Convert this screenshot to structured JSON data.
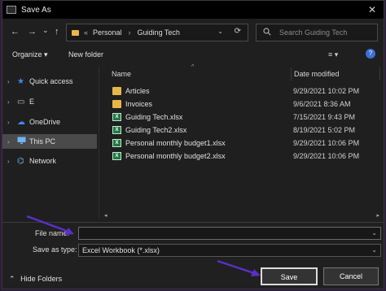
{
  "window": {
    "title": "Save As",
    "close_glyph": "✕"
  },
  "nav": {
    "back_glyph": "←",
    "forward_glyph": "→",
    "recent_glyph": "⌄",
    "up_glyph": "↑",
    "breadcrumb": {
      "prefix": "«",
      "items": [
        "Personal",
        "Guiding Tech"
      ],
      "separator": "›"
    },
    "dropdown_glyph": "⌄",
    "refresh_glyph": "⟳"
  },
  "search": {
    "placeholder": "Search Guiding Tech",
    "icon": "search-icon"
  },
  "toolbar": {
    "organize": "Organize ▾",
    "new_folder": "New folder",
    "view_glyph": "≡ ▾",
    "help_glyph": "?"
  },
  "sidebar": {
    "items": [
      {
        "label": "Quick access",
        "icon": "star-icon",
        "glyph": "★",
        "color": "#3d8bf2"
      },
      {
        "label": "E",
        "icon": "drive-icon",
        "glyph": "▭",
        "color": "#bdbdbd"
      },
      {
        "label": "OneDrive",
        "icon": "cloud-icon",
        "glyph": "☁",
        "color": "#3d8bf2"
      },
      {
        "label": "This PC",
        "icon": "computer-icon",
        "glyph": "🖥",
        "color": "#6fb5f0",
        "selected": true
      },
      {
        "label": "Network",
        "icon": "network-icon",
        "glyph": "⌬",
        "color": "#6fb5f0"
      }
    ]
  },
  "files": {
    "columns": {
      "name": "Name",
      "date": "Date modified"
    },
    "rows": [
      {
        "name": "Articles",
        "date": "9/29/2021 10:02 PM",
        "type": "folder"
      },
      {
        "name": "Invoices",
        "date": "9/6/2021 8:36 AM",
        "type": "folder"
      },
      {
        "name": "Guiding Tech.xlsx",
        "date": "7/15/2021 9:43 PM",
        "type": "xlsx"
      },
      {
        "name": "Guiding Tech2.xlsx",
        "date": "8/19/2021 5:02 PM",
        "type": "xlsx"
      },
      {
        "name": "Personal monthly budget1.xlsx",
        "date": "9/29/2021 10:06 PM",
        "type": "xlsx"
      },
      {
        "name": "Personal monthly budget2.xlsx",
        "date": "9/29/2021 10:06 PM",
        "type": "xlsx"
      }
    ]
  },
  "form": {
    "file_name_label": "File name:",
    "file_name_value": "",
    "save_type_label": "Save as type:",
    "save_type_value": "Excel Workbook (*.xlsx)",
    "hide_folders": "Hide Folders",
    "save": "Save",
    "cancel": "Cancel"
  },
  "colors": {
    "accent": "#3d8bf2",
    "annotation_arrow": "#5b2fc9",
    "folder": "#e8b74a",
    "excel": "#1f7a44"
  }
}
